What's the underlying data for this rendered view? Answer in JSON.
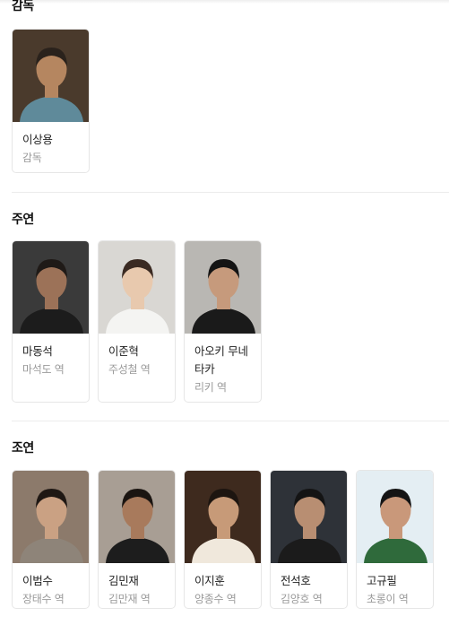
{
  "sections": [
    {
      "title": "감독",
      "people": [
        {
          "name": "이상용",
          "role": "감독",
          "bg": "#4a3a2c",
          "skin": "#b58660",
          "hair": "#2a221c",
          "shirt": "#5f8a9a"
        }
      ]
    },
    {
      "title": "주연",
      "people": [
        {
          "name": "마동석",
          "role": "마석도 역",
          "bg": "#3a3a3a",
          "skin": "#9c7258",
          "hair": "#1f1a17",
          "shirt": "#1c1c1c"
        },
        {
          "name": "이준혁",
          "role": "주성철 역",
          "bg": "#d9d7d3",
          "skin": "#e8c9ae",
          "hair": "#3a2a22",
          "shirt": "#f4f4f2"
        },
        {
          "name": "아오키 무네타카",
          "role": "리키 역",
          "bg": "#b9b7b3",
          "skin": "#c69a7c",
          "hair": "#141414",
          "shirt": "#1a1a1a"
        }
      ]
    },
    {
      "title": "조연",
      "people": [
        {
          "name": "이범수",
          "role": "장태수 역",
          "bg": "#8c7a6b",
          "skin": "#caa183",
          "hair": "#1f1814",
          "shirt": "#8e8479"
        },
        {
          "name": "김민재",
          "role": "김만재 역",
          "bg": "#a89e94",
          "skin": "#a87a5c",
          "hair": "#1b1511",
          "shirt": "#1d1d1d"
        },
        {
          "name": "이지훈",
          "role": "양종수 역",
          "bg": "#3e2a1e",
          "skin": "#c79a78",
          "hair": "#1d1510",
          "shirt": "#f0e8dc"
        },
        {
          "name": "전석호",
          "role": "김양호 역",
          "bg": "#2e3238",
          "skin": "#b88e72",
          "hair": "#141414",
          "shirt": "#1b1b1b"
        },
        {
          "name": "고규필",
          "role": "초롱이 역",
          "bg": "#e4eef3",
          "skin": "#c9987a",
          "hair": "#141414",
          "shirt": "#2f6a3b"
        }
      ]
    }
  ]
}
